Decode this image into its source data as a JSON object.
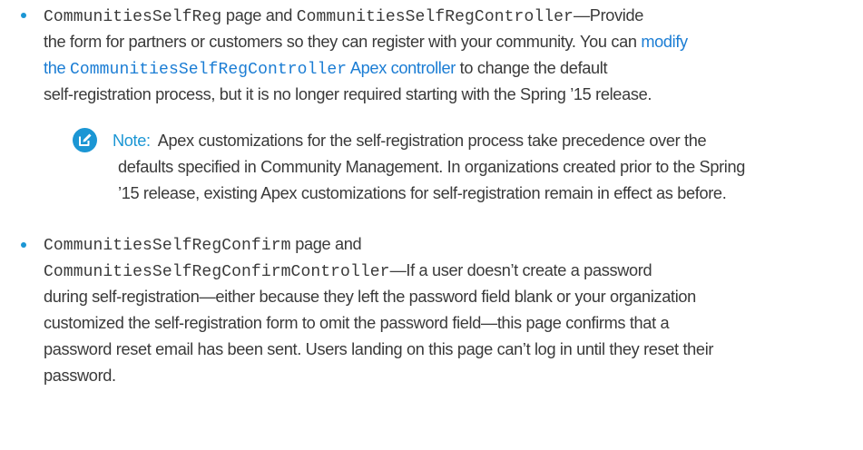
{
  "colors": {
    "accent": "#1B96D4",
    "text": "#3A3A3A",
    "link": "#1B7DD4"
  },
  "bullet1": {
    "code1": "CommunitiesSelfReg",
    "t1": " page and ",
    "code2": "CommunitiesSelfRegController",
    "t2": "—Provide",
    "line2": "the form for partners or customers so they can register with your community. You can ",
    "link_a": "modify",
    "link_b": "the ",
    "link_code": "CommunitiesSelfRegController",
    "link_c": " Apex controller",
    "line3_rest": " to change the default",
    "line4": "self-registration process, but it is no longer required starting with the Spring ’15 release."
  },
  "note": {
    "icon": "edit-note-icon",
    "label": "Note:",
    "line1": "Apex customizations for the self-registration process take precedence over the",
    "line2": "defaults specified in Community Management. In organizations created prior to the Spring",
    "line3": "’15 release, existing Apex customizations for self-registration remain in effect as before."
  },
  "bullet2": {
    "code1": "CommunitiesSelfRegConfirm",
    "t1": " page and",
    "code2": "CommunitiesSelfRegConfirmController",
    "t2": "—If a user doesn’t create a password",
    "line3": "during self-registration—either because they left the password field blank or your organization",
    "line4": "customized the self-registration form to omit the password field—this page confirms that a",
    "line5": "password reset email has been sent. Users landing on this page can’t log in until they reset their",
    "line6": "password."
  }
}
